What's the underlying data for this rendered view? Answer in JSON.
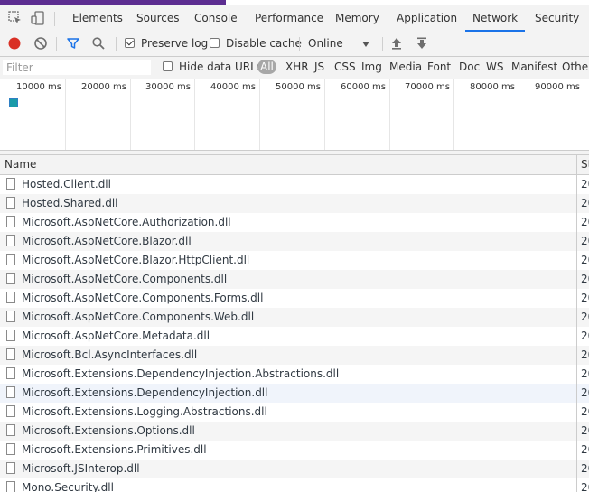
{
  "tabs": [
    "Elements",
    "Sources",
    "Console",
    "Performance",
    "Memory",
    "Application",
    "Network",
    "Security"
  ],
  "active_tab": "Network",
  "toolbar": {
    "preserve_log_label": "Preserve log",
    "preserve_log_checked": true,
    "disable_cache_label": "Disable cache",
    "disable_cache_checked": false,
    "throttling_value": "Online",
    "icons": [
      "record-icon",
      "clear-icon",
      "filter-icon",
      "search-icon",
      "import-icon",
      "export-icon"
    ]
  },
  "filterbar": {
    "placeholder": "Filter",
    "hide_data_urls_label": "Hide data URLs",
    "hide_data_urls_checked": false,
    "types": [
      "All",
      "XHR",
      "JS",
      "CSS",
      "Img",
      "Media",
      "Font",
      "Doc",
      "WS",
      "Manifest",
      "Other"
    ]
  },
  "overview": {
    "ticks": [
      "10000 ms",
      "20000 ms",
      "30000 ms",
      "40000 ms",
      "50000 ms",
      "60000 ms",
      "70000 ms",
      "80000 ms",
      "90000 ms"
    ]
  },
  "table": {
    "headers": {
      "name": "Name",
      "status": "St"
    },
    "rows": [
      {
        "name": "Hosted.Client.dll",
        "status": "20"
      },
      {
        "name": "Hosted.Shared.dll",
        "status": "20"
      },
      {
        "name": "Microsoft.AspNetCore.Authorization.dll",
        "status": "20"
      },
      {
        "name": "Microsoft.AspNetCore.Blazor.dll",
        "status": "20"
      },
      {
        "name": "Microsoft.AspNetCore.Blazor.HttpClient.dll",
        "status": "20"
      },
      {
        "name": "Microsoft.AspNetCore.Components.dll",
        "status": "20"
      },
      {
        "name": "Microsoft.AspNetCore.Components.Forms.dll",
        "status": "20"
      },
      {
        "name": "Microsoft.AspNetCore.Components.Web.dll",
        "status": "20"
      },
      {
        "name": "Microsoft.AspNetCore.Metadata.dll",
        "status": "20"
      },
      {
        "name": "Microsoft.Bcl.AsyncInterfaces.dll",
        "status": "20"
      },
      {
        "name": "Microsoft.Extensions.DependencyInjection.Abstractions.dll",
        "status": "20"
      },
      {
        "name": "Microsoft.Extensions.DependencyInjection.dll",
        "status": "20"
      },
      {
        "name": "Microsoft.Extensions.Logging.Abstractions.dll",
        "status": "20"
      },
      {
        "name": "Microsoft.Extensions.Options.dll",
        "status": "20"
      },
      {
        "name": "Microsoft.Extensions.Primitives.dll",
        "status": "20"
      },
      {
        "name": "Microsoft.JSInterop.dll",
        "status": "20"
      },
      {
        "name": "Mono.Security.dll",
        "status": "20"
      }
    ]
  },
  "colors": {
    "accent": "#1a73e8",
    "record": "#d93025",
    "brand_stripe": "#5c2d91"
  }
}
